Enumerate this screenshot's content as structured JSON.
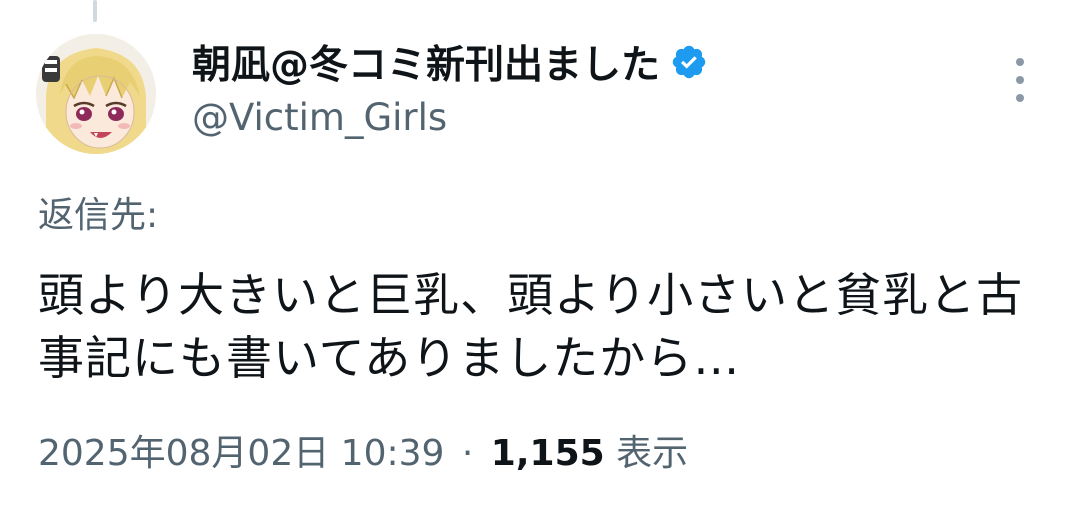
{
  "tweet": {
    "display_name": "朝凪@冬コミ新刊出ました",
    "handle": "@Victim_Girls",
    "verified": true,
    "reply_to_label": "返信先:",
    "text": "頭より大きいと巨乳、頭より小さいと貧乳と古事記にも書いてありましたから…",
    "timestamp": "2025年08月02日 10:39",
    "separator": "·",
    "views_count": "1,155",
    "views_label": "表示"
  },
  "colors": {
    "verified_blue": "#1d9bf0",
    "secondary_text": "#536471",
    "primary_text": "#0f1419"
  },
  "icons": {
    "avatar": "avatar-illustration",
    "verified": "verified-badge-icon",
    "more": "more-options-icon"
  }
}
